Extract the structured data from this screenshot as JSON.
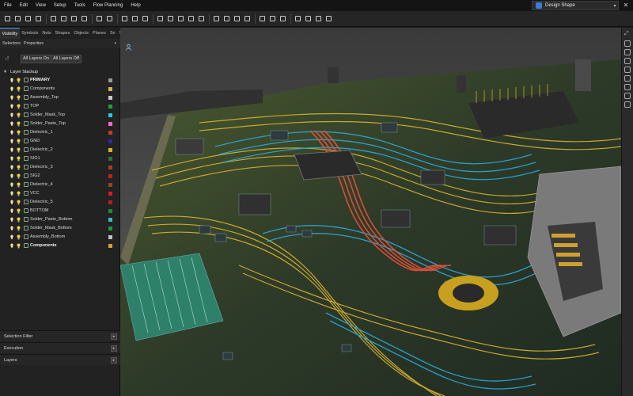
{
  "menu": [
    "File",
    "Edit",
    "View",
    "Setup",
    "Tools",
    "Flow Planning",
    "Help"
  ],
  "mode": {
    "label": "Design Shape",
    "icon": "design-shape-icon"
  },
  "window": {
    "close_icon": "close-icon"
  },
  "toolbar": {
    "icons": [
      "new-file-icon",
      "open-folder-icon",
      "save-icon",
      "print-icon",
      "cut-icon",
      "copy-icon",
      "paste-icon",
      "undo-icon",
      "redo-icon",
      "route-icon",
      "via-icon",
      "add-connect-icon",
      "delete-icon",
      "zoom-fit-icon",
      "zoom-in-icon",
      "zoom-out-icon",
      "zoom-previous-icon",
      "refresh-icon",
      "grid-icon",
      "measure-icon",
      "3d-view-icon",
      "layers-icon",
      "highlight-icon",
      "dehighlight-icon",
      "mirror-icon",
      "rotate-icon",
      "shape-icon",
      "drc-icon",
      "report-icon"
    ]
  },
  "panel_tabs": [
    "Visibility",
    "Symbols",
    "Nets",
    "Shapes",
    "Objects",
    "Planes",
    "Sn",
    "Selectors"
  ],
  "subtabs": [
    "Selectors",
    "Properties"
  ],
  "buttons": {
    "all_layers_on": "All Layers On",
    "all_layers_off": "All Layers Off"
  },
  "stackup": {
    "title": "Layer Stackup",
    "layers": [
      {
        "name": "PRIMARY",
        "color": "#9a9a9a",
        "bold": true
      },
      {
        "name": "Components",
        "color": "#d9b24a",
        "bold": false
      },
      {
        "name": "Assembly_Top",
        "color": "#c9c9c9",
        "bold": false
      },
      {
        "name": "TOP",
        "color": "#1f9e3a",
        "bold": false
      },
      {
        "name": "Solder_Mask_Top",
        "color": "#28c8d8",
        "bold": false
      },
      {
        "name": "Solder_Paste_Top",
        "color": "#ff66cc",
        "bold": false
      },
      {
        "name": "Dielectric_1",
        "color": "#c43a2a",
        "bold": false
      },
      {
        "name": "GND",
        "color": "#2a2ab0",
        "bold": false
      },
      {
        "name": "Dielectric_2",
        "color": "#e0b020",
        "bold": false
      },
      {
        "name": "SIG1",
        "color": "#1f7a30",
        "bold": false
      },
      {
        "name": "Dielectric_3",
        "color": "#a04020",
        "bold": false
      },
      {
        "name": "SIG2",
        "color": "#c02020",
        "bold": false
      },
      {
        "name": "Dielectric_4",
        "color": "#8a4a20",
        "bold": false
      },
      {
        "name": "VCC",
        "color": "#d02020",
        "bold": false
      },
      {
        "name": "Dielectric_5",
        "color": "#b02020",
        "bold": false
      },
      {
        "name": "BOTTOM",
        "color": "#1a8a30",
        "bold": false
      },
      {
        "name": "Solder_Paste_Bottom",
        "color": "#30c0c0",
        "bold": false
      },
      {
        "name": "Solder_Mask_Bottom",
        "color": "#1a9a40",
        "bold": false
      },
      {
        "name": "Assembly_Bottom",
        "color": "#c0c0c0",
        "bold": false
      },
      {
        "name": "Components",
        "color": "#d0a030",
        "bold": true
      }
    ]
  },
  "bottom_sections": [
    "Selection Filter",
    "Execution",
    "Layers"
  ],
  "right_strip_icons": [
    "view-top-icon",
    "view-bottom-icon",
    "view-left-icon",
    "view-right-icon",
    "view-front-icon",
    "view-back-icon",
    "view-iso-icon",
    "settings-icon"
  ]
}
